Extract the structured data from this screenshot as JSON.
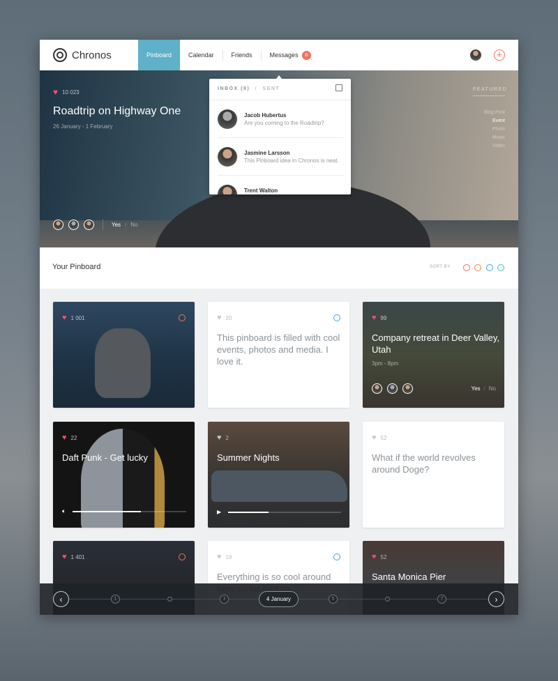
{
  "app": {
    "name": "Chronos"
  },
  "nav": {
    "tabs": [
      {
        "label": "Pinboard",
        "active": true
      },
      {
        "label": "Calendar"
      },
      {
        "label": "Friends"
      },
      {
        "label": "Messages",
        "badge": "8"
      }
    ],
    "add_icon": "plus-circle-icon"
  },
  "hero": {
    "likes": "10 023",
    "title": "Roadtrip on Highway One",
    "dates": "26 January - 1 February",
    "rsvp_yes": "Yes",
    "rsvp_sep": "/",
    "rsvp_no": "No",
    "featured": {
      "heading": "FEATURED",
      "items": [
        {
          "label": "Blog Post"
        },
        {
          "label": "Event",
          "active": true
        },
        {
          "label": "Photo"
        },
        {
          "label": "Music"
        },
        {
          "label": "Video"
        }
      ]
    }
  },
  "messages": {
    "inbox": "INBOX (8)",
    "sep": "/",
    "sent": "SENT",
    "items": [
      {
        "name": "Jacob Hubertus",
        "preview": "Are you coming to the Roadtrip?"
      },
      {
        "name": "Jasmine Larsson",
        "preview": "This Pinboard idea in Chronos is neat."
      },
      {
        "name": "Trent Walton",
        "preview": ""
      }
    ]
  },
  "pinboard": {
    "title": "Your Pinboard",
    "sort_label": "SORT BY",
    "sort_colors": [
      "#f0735a",
      "#f0883a",
      "#3ca7e0",
      "#36c6c0"
    ]
  },
  "cards": [
    {
      "likes": "1 001",
      "type": "photo",
      "dot": "#f0735a"
    },
    {
      "likes": "20",
      "text": "This pinboard is filled with cool events, photos and media. I love it.",
      "dot": "#3ca7e0"
    },
    {
      "likes": "99",
      "title": "Company retreat in Deer Valley, Utah",
      "time": "3pm - 8pm",
      "yes": "Yes",
      "sep": "/",
      "no": "No"
    },
    {
      "likes": "22",
      "title": "Daft Punk - Get lucky",
      "progress": 0.6
    },
    {
      "likes": "2",
      "title": "Summer Nights",
      "progress": 0.36
    },
    {
      "likes": "52",
      "text": "What if the world revolves around Doge?"
    },
    {
      "likes": "1 401",
      "dot": "#f0735a"
    },
    {
      "likes": "19",
      "text": "Everything is so cool around here so far bad hu...",
      "dot": "#3ca7e0"
    },
    {
      "likes": "52",
      "title": "Santa Monica Pier"
    }
  ],
  "timeline": {
    "nodes": [
      "1",
      "",
      "3",
      "4 January",
      "5",
      "",
      "7"
    ],
    "current": "4 January"
  }
}
